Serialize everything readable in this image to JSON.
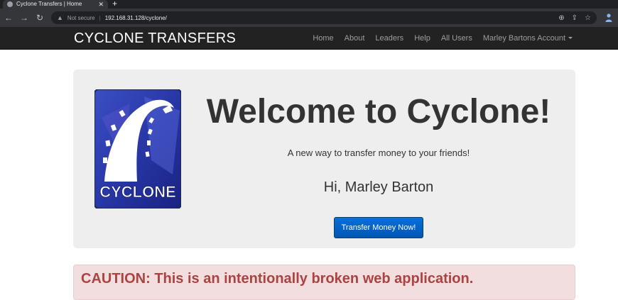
{
  "browser": {
    "tab_title": "Cyclone Transfers | Home",
    "url_warning": "Not secure",
    "url": "192.168.31.128/cyclone/"
  },
  "navbar": {
    "brand": "CYCLONE TRANSFERS",
    "links": [
      "Home",
      "About",
      "Leaders",
      "Help",
      "All Users"
    ],
    "account": "Marley Bartons Account"
  },
  "hero": {
    "logo_text": "CYCLONE",
    "title": "Welcome to Cyclone!",
    "subtitle": "A new way to transfer money to your friends!",
    "greeting": "Hi, Marley Barton",
    "cta": "Transfer Money Now!"
  },
  "alert": {
    "text": "CAUTION: This is an intentionally broken web application."
  },
  "colors": {
    "navbar_bg": "#222222",
    "jumbotron_bg": "#eeeeee",
    "button": "#0a6edc",
    "alert_bg": "#f2dede",
    "alert_text": "#a94442"
  }
}
